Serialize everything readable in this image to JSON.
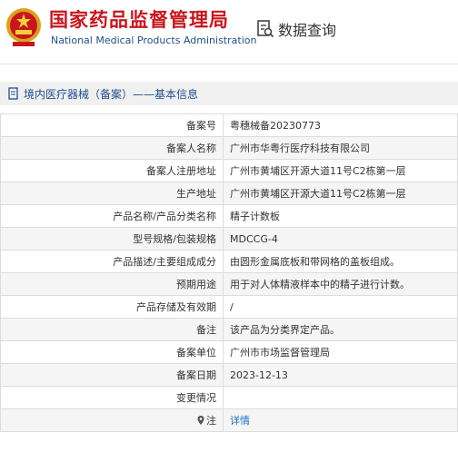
{
  "header": {
    "title_cn": "国家药品监督管理局",
    "title_en": "National Medical Products Administration",
    "query_label": "数据查询"
  },
  "breadcrumb": {
    "text": "境内医疗器械（备案）——基本信息"
  },
  "details": [
    {
      "label": "备案号",
      "value": "粤穗械备20230773"
    },
    {
      "label": "备案人名称",
      "value": "广州市华粤行医疗科技有限公司"
    },
    {
      "label": "备案人注册地址",
      "value": "广州市黄埔区开源大道11号C2栋第一层"
    },
    {
      "label": "生产地址",
      "value": "广州市黄埔区开源大道11号C2栋第一层"
    },
    {
      "label": "产品名称/产品分类名称",
      "value": "精子计数板"
    },
    {
      "label": "型号规格/包装规格",
      "value": "MDCCG-4"
    },
    {
      "label": "产品描述/主要组成成分",
      "value": "由圆形金属底板和带网格的盖板组成。"
    },
    {
      "label": "预期用途",
      "value": "用于对人体精液样本中的精子进行计数。"
    },
    {
      "label": "产品存储及有效期",
      "value": "/"
    },
    {
      "label": "备注",
      "value": "该产品为分类界定产品。"
    },
    {
      "label": "备案单位",
      "value": "广州市市场监督管理局"
    },
    {
      "label": "备案日期",
      "value": "2023-12-13"
    },
    {
      "label": "变更情况",
      "value": ""
    },
    {
      "label": "注",
      "value": "详情"
    }
  ],
  "colors": {
    "brand_red": "#c8161d",
    "brand_blue": "#1f4f8f",
    "link": "#1f6fc4"
  }
}
